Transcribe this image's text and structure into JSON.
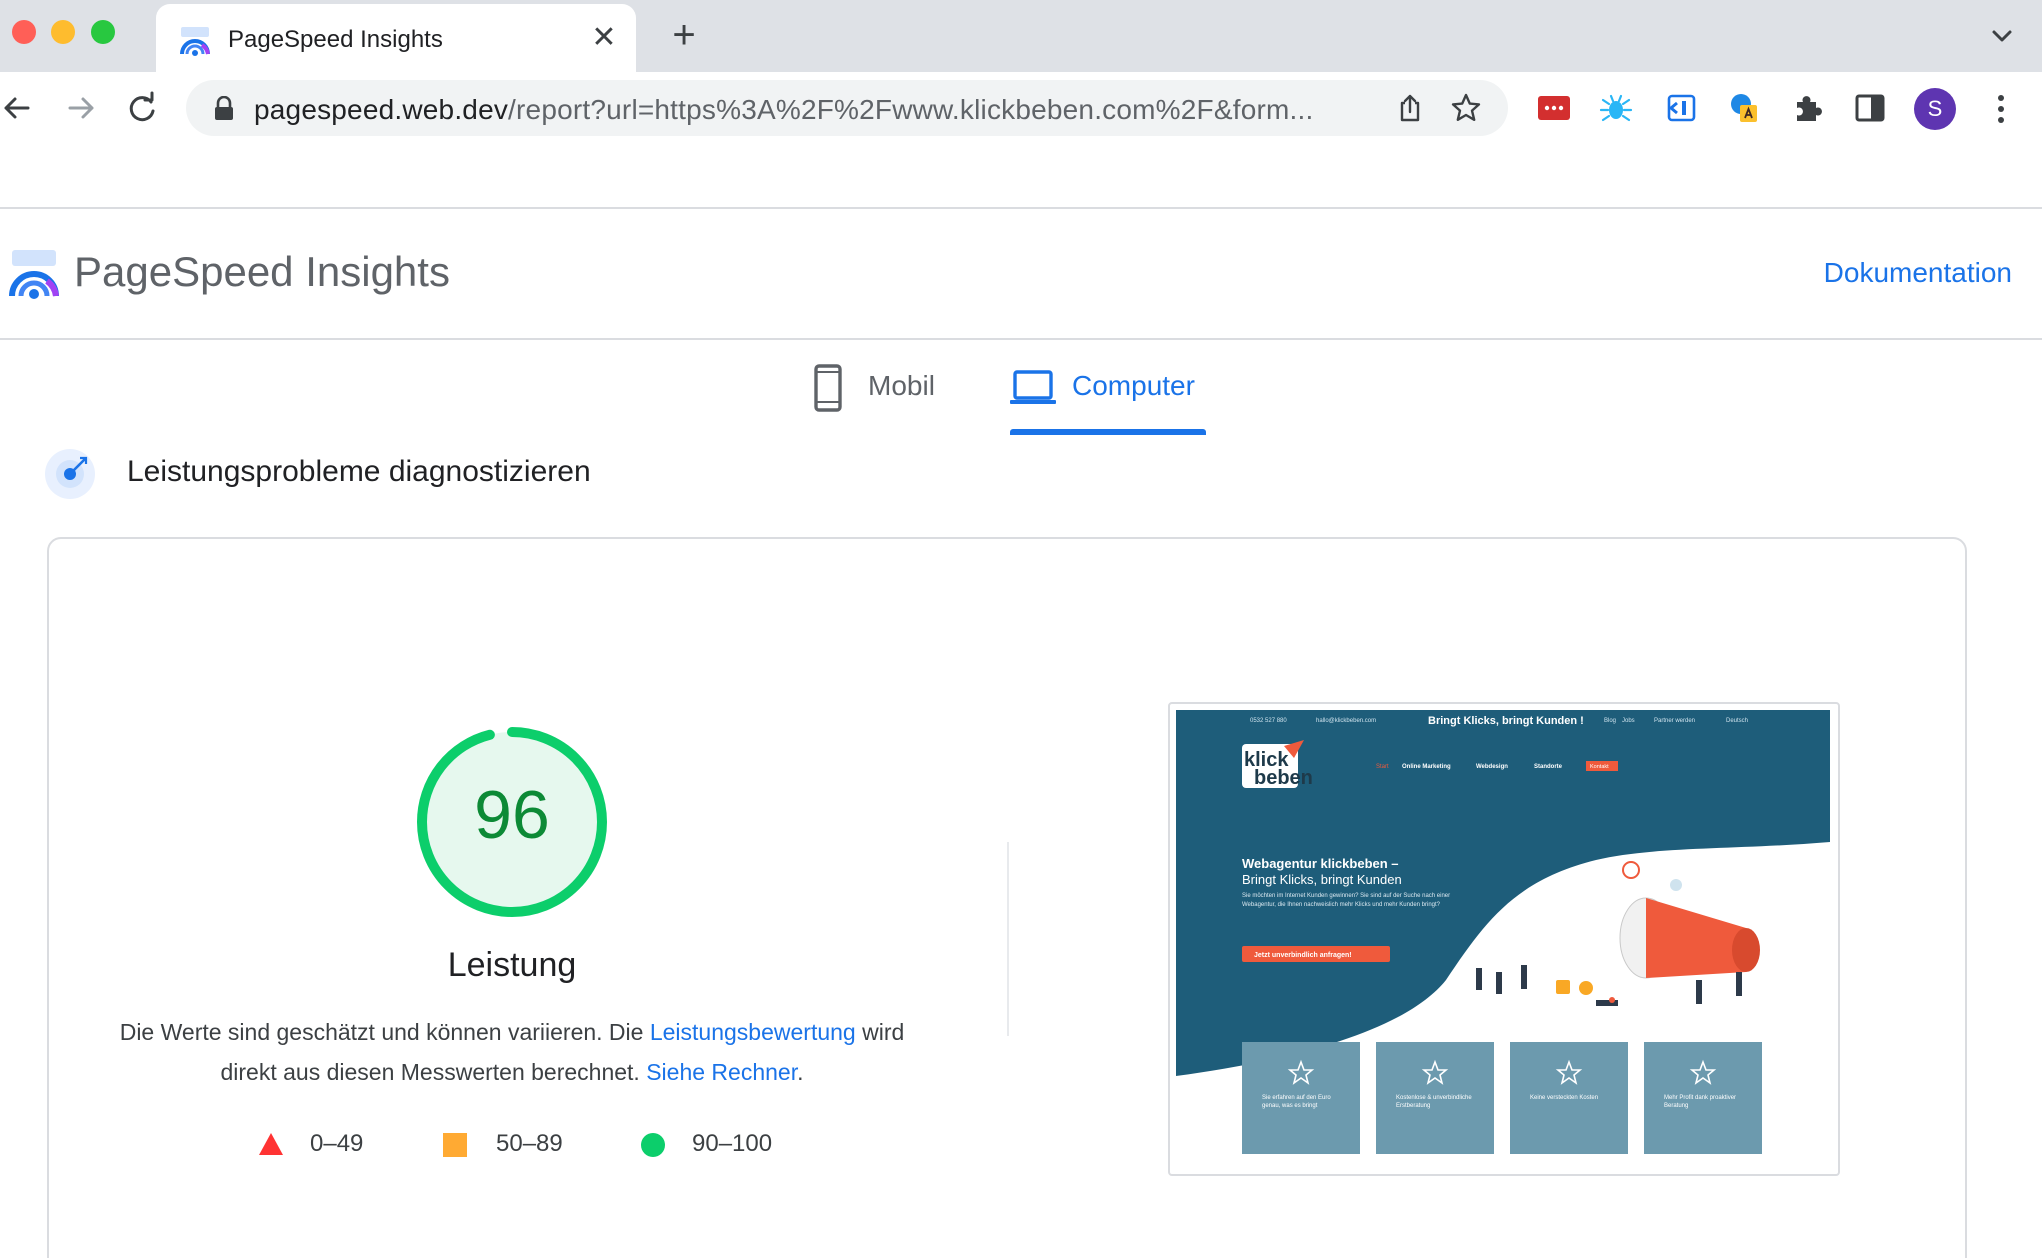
{
  "browser": {
    "tab": {
      "title": "PageSpeed Insights"
    },
    "new_tab": "+",
    "url_host": "pagespeed.web.dev",
    "url_path": "/report?url=https%3A%2F%2Fwww.klickbeben.com%2F&form...",
    "profile_initial": "S"
  },
  "header": {
    "title": "PageSpeed Insights",
    "doc_link": "Dokumentation"
  },
  "device_tabs": [
    {
      "label": "Mobil",
      "selected": false
    },
    {
      "label": "Computer",
      "selected": true
    }
  ],
  "diagnose": {
    "title": "Leistungsprobleme diagnostizieren"
  },
  "performance": {
    "score": "96",
    "score_fraction": 0.96,
    "label": "Leistung",
    "desc_part1": "Die Werte sind geschätzt und können variieren. Die ",
    "desc_link1": "Leistungsbewertung",
    "desc_part2": " wird direkt aus diesen Messwerten berechnet. ",
    "desc_link2": "Siehe Rechner",
    "desc_end": ".",
    "legend": [
      {
        "range": "0–49",
        "color": "#ff3333",
        "shape": "triangle"
      },
      {
        "range": "50–89",
        "color": "#ffaa33",
        "shape": "square"
      },
      {
        "range": "90–100",
        "color": "#0cce6b",
        "shape": "circle"
      }
    ]
  },
  "thumbnail": {
    "topbar_phone": "0532 527 880",
    "topbar_email": "hallo@klickbeben.com",
    "tagline": "Bringt Klicks, bringt Kunden !",
    "topbar_links": [
      "Blog",
      "Jobs",
      "Partner werden",
      "Deutsch"
    ],
    "logo_line1": "klick",
    "logo_line2": "beben",
    "nav": [
      "Start",
      "Online Marketing",
      "Webdesign",
      "Standorte",
      "Kontakt"
    ],
    "hero_title_1": "Webagentur klickbeben –",
    "hero_title_2": "Bringt Klicks, bringt Kunden",
    "hero_text": "Sie möchten im Internet Kunden gewinnen? Sie sind auf der Suche nach einer Webagentur, die Ihnen nachweislich mehr Klicks und mehr Kunden bringt?",
    "cta": "Jetzt unverbindlich anfragen!",
    "cards": [
      "Sie erfahren auf den Euro genau, was es bringt",
      "Kostenlose & unverbindliche Erstberatung",
      "Keine versteckten Kosten",
      "Mehr Profit dank proaktiver Beratung"
    ]
  }
}
